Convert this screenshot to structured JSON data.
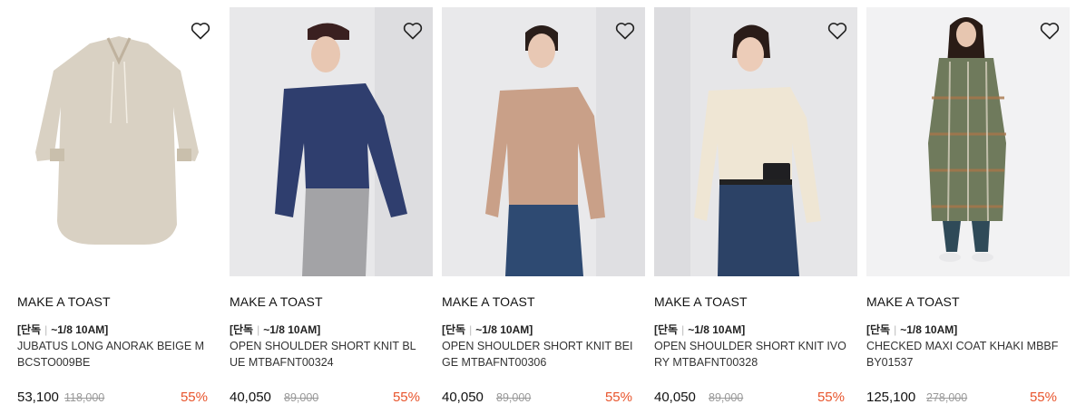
{
  "products": [
    {
      "brand": "MAKE A TOAST",
      "tag_main": "[단독",
      "tag_sub": "~1/8 10AM]",
      "name": "JUBATUS LONG ANORAK BEIGE MBCSTO009BE",
      "price": "53,100",
      "original_price": "118,000",
      "discount": "55%",
      "icon": "heart-outline-icon"
    },
    {
      "brand": "MAKE A TOAST",
      "tag_main": "[단독",
      "tag_sub": "~1/8 10AM]",
      "name": "OPEN SHOULDER SHORT KNIT BLUE MTBAFNT00324",
      "price": "40,050",
      "original_price": "89,000",
      "discount": "55%",
      "icon": "heart-outline-icon"
    },
    {
      "brand": "MAKE A TOAST",
      "tag_main": "[단독",
      "tag_sub": "~1/8 10AM]",
      "name": "OPEN SHOULDER SHORT KNIT BEIGE MTBAFNT00306",
      "price": "40,050",
      "original_price": "89,000",
      "discount": "55%",
      "icon": "heart-outline-icon"
    },
    {
      "brand": "MAKE A TOAST",
      "tag_main": "[단독",
      "tag_sub": "~1/8 10AM]",
      "name": "OPEN SHOULDER SHORT KNIT IVORY MTBAFNT00328",
      "price": "40,050",
      "original_price": "89,000",
      "discount": "55%",
      "icon": "heart-outline-icon"
    },
    {
      "brand": "MAKE A TOAST",
      "tag_main": "[단독",
      "tag_sub": "~1/8 10AM]",
      "name": "CHECKED MAXI COAT KHAKI MBBFBY01537",
      "price": "125,100",
      "original_price": "278,000",
      "discount": "55%",
      "icon": "heart-outline-icon"
    }
  ],
  "colors": {
    "discount": "#e8542c",
    "original_price": "#999999"
  }
}
